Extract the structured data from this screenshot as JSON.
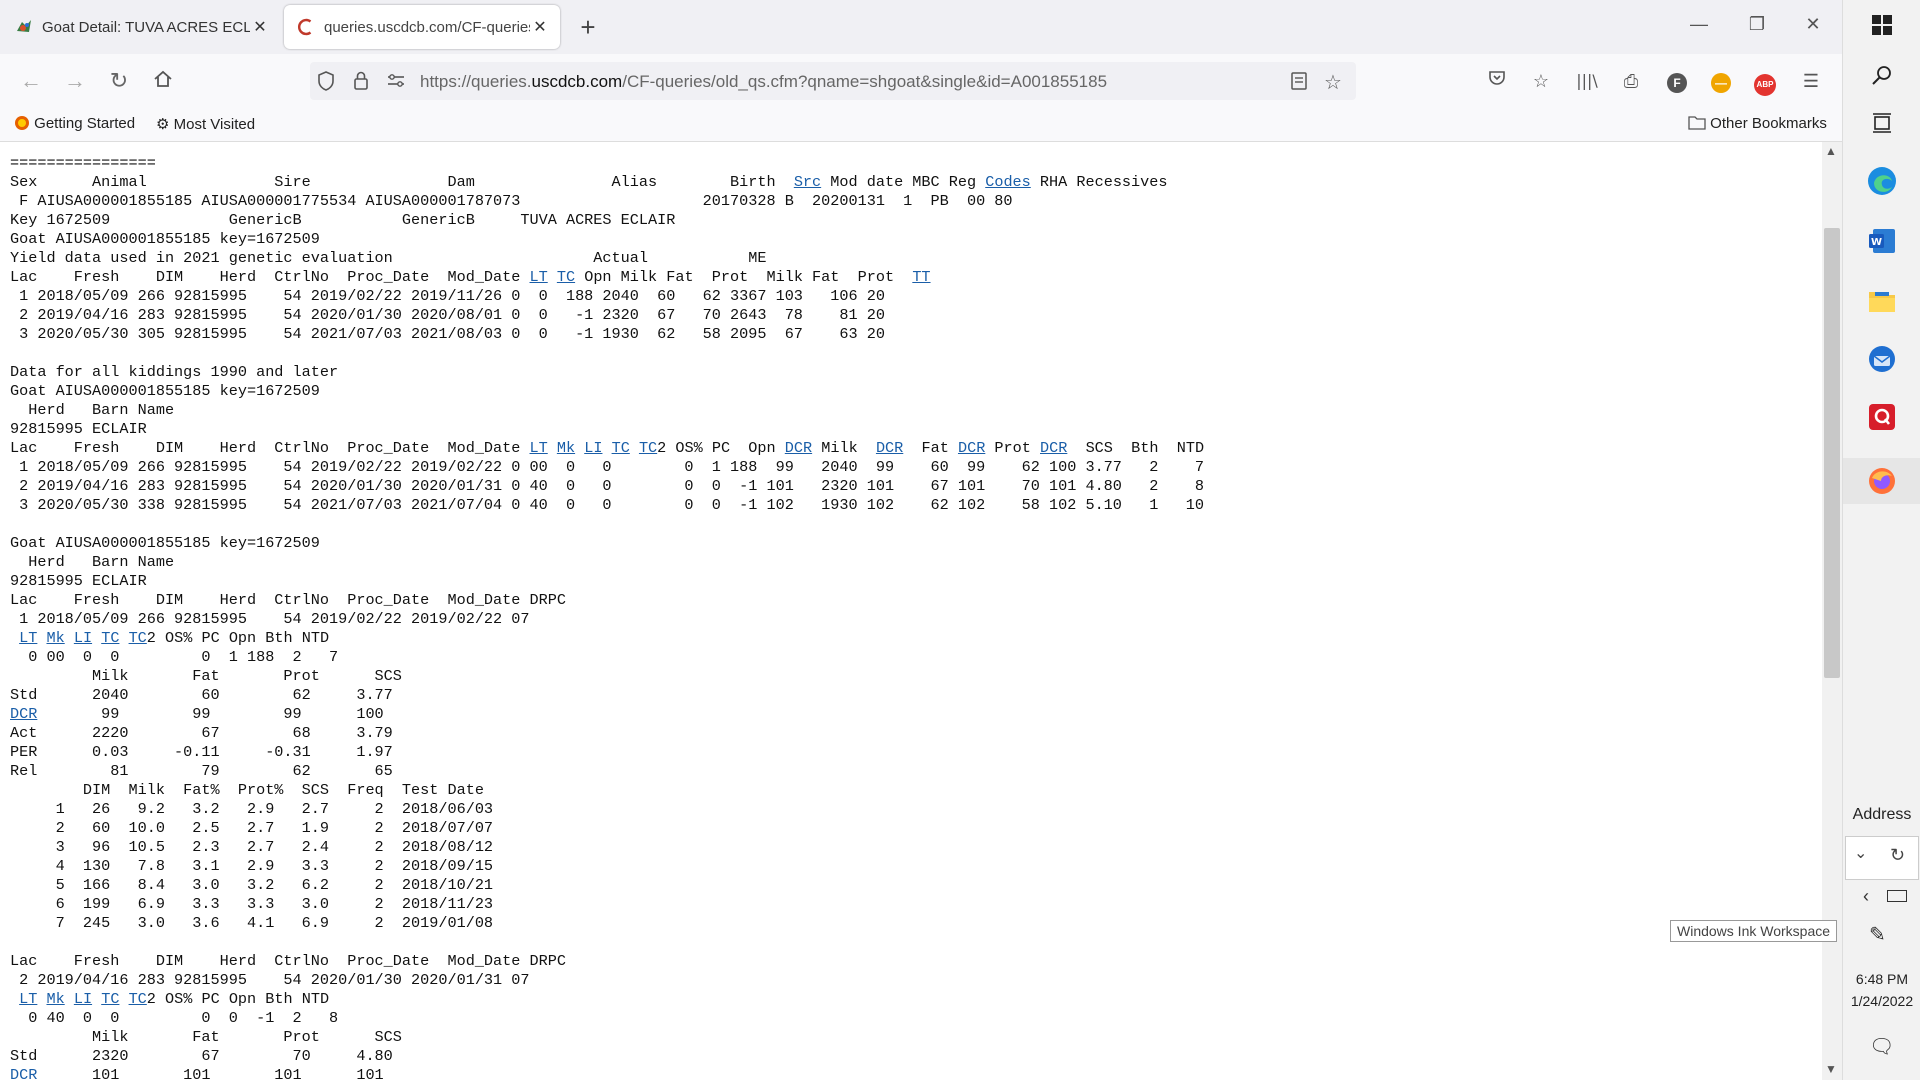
{
  "tabs": [
    {
      "title": "Goat Detail: TUVA ACRES ECLAI",
      "close": "✕"
    },
    {
      "title": "queries.uscdcb.com/CF-queries/",
      "close": "✕"
    }
  ],
  "new_tab": "+",
  "url": {
    "prefix": "https://queries.",
    "domain": "uscdcb.com",
    "path": "/CF-queries/old_qs.cfm?qname=shgoat&single&id=A001855185"
  },
  "bookmarks": {
    "getting_started": "Getting Started",
    "most_visited": "Most Visited",
    "other": "Other Bookmarks"
  },
  "toolbar": {
    "account_letter": "F",
    "abp": "ABP"
  },
  "taskbar": {
    "address_label": "Address",
    "time": "6:48 PM",
    "date": "1/24/2022",
    "ink_tooltip": "Windows Ink Workspace"
  },
  "report": {
    "rule": "================",
    "hdr_a": "Sex      Animal              Sire               Dam               Alias        Birth  ",
    "hdr_src": "Src",
    "hdr_b": " Mod date MBC Reg ",
    "hdr_codes": "Codes",
    "hdr_c": " RHA Recessives",
    "ident_row": " F AIUSA000001855185 AIUSA000001775534 AIUSA000001787073                    20170328 B  20200131  1  PB  00 80",
    "key_row": "Key 1672509             GenericB           GenericB     TUVA ACRES ECLAIR",
    "goat_key": "Goat AIUSA000001855185 key=1672509",
    "yield_title": "Yield data used in 2021 genetic evaluation                      Actual           ME",
    "yield_hdr_a": "Lac    Fresh    DIM    Herd  CtrlNo  Proc_Date  Mod_Date ",
    "lnk_LT": "LT",
    "lnk_TC": "TC",
    "lnk_Mk": "Mk",
    "lnk_LI": "LI",
    "lnk_TC2": "TC",
    "lnk_TT": "TT",
    "lnk_DCR": "DCR",
    "yield_hdr_b": " Opn Milk Fat  Prot  Milk Fat  Prot  ",
    "yield_rows": [
      " 1 2018/05/09 266 92815995    54 2019/02/22 2019/11/26 0  0  188 2040  60   62 3367 103   106 20",
      " 2 2019/04/16 283 92815995    54 2020/01/30 2020/08/01 0  0   -1 2320  67   70 2643  78    81 20",
      " 3 2020/05/30 305 92815995    54 2021/07/03 2021/08/03 0  0   -1 1930  62   58 2095  67    63 20"
    ],
    "kiddings_title": "Data for all kiddings 1990 and later",
    "herd_hdr": "  Herd   Barn Name",
    "herd_row": "92815995 ECLAIR",
    "kid_hdr_2": "2 OS% PC  Opn ",
    "kid_hdr_milk": " Milk  ",
    "kid_hdr_fat": "  Fat ",
    "kid_hdr_prot": " Prot ",
    "kid_hdr_end": "  SCS  Bth  NTD",
    "kid_rows": [
      " 1 2018/05/09 266 92815995    54 2019/02/22 2019/02/22 0 00  0   0        0  1 188  99   2040  99    60  99    62 100 3.77   2    7",
      " 2 2019/04/16 283 92815995    54 2020/01/30 2020/01/31 0 40  0   0        0  0  -1 101   2320 101    67 101    70 101 4.80   2    8",
      " 3 2020/05/30 338 92815995    54 2021/07/03 2021/07/04 0 40  0   0        0  0  -1 102   1930 102    62 102    58 102 5.10   1   10"
    ],
    "lac_hdr": "Lac    Fresh    DIM    Herd  CtrlNo  Proc_Date  Mod_Date DRPC",
    "lac1_row": " 1 2018/05/09 266 92815995    54 2019/02/22 2019/02/22 07",
    "sub_hdr_end": "2 OS% PC Opn Bth NTD",
    "lac1_sub": "  0 00  0  0         0  1 188  2   7",
    "comp_hdr": "         Milk       Fat       Prot      SCS",
    "lac1_std": "Std      2040        60        62     3.77",
    "lac1_dcr": "       99        99        99      100",
    "lac1_act": "Act      2220        67        68     3.79",
    "lac1_per": "PER      0.03     -0.11     -0.31     1.97",
    "lac1_rel": "Rel        81        79        62       65",
    "test_hdr": "        DIM  Milk  Fat%  Prot%  SCS  Freq  Test Date",
    "tests": [
      "     1   26   9.2   3.2   2.9   2.7     2  2018/06/03",
      "     2   60  10.0   2.5   2.7   1.9     2  2018/07/07",
      "     3   96  10.5   2.3   2.7   2.4     2  2018/08/12",
      "     4  130   7.8   3.1   2.9   3.3     2  2018/09/15",
      "     5  166   8.4   3.0   3.2   6.2     2  2018/10/21",
      "     6  199   6.9   3.3   3.3   3.0     2  2018/11/23",
      "     7  245   3.0   3.6   4.1   6.9     2  2019/01/08"
    ],
    "lac2_row": " 2 2019/04/16 283 92815995    54 2020/01/30 2020/01/31 07",
    "lac2_sub": "  0 40  0  0         0  0  -1  2   8",
    "lac2_std": "Std      2320        67        70     4.80",
    "lac2_dcr": "      101       101       101      101"
  }
}
